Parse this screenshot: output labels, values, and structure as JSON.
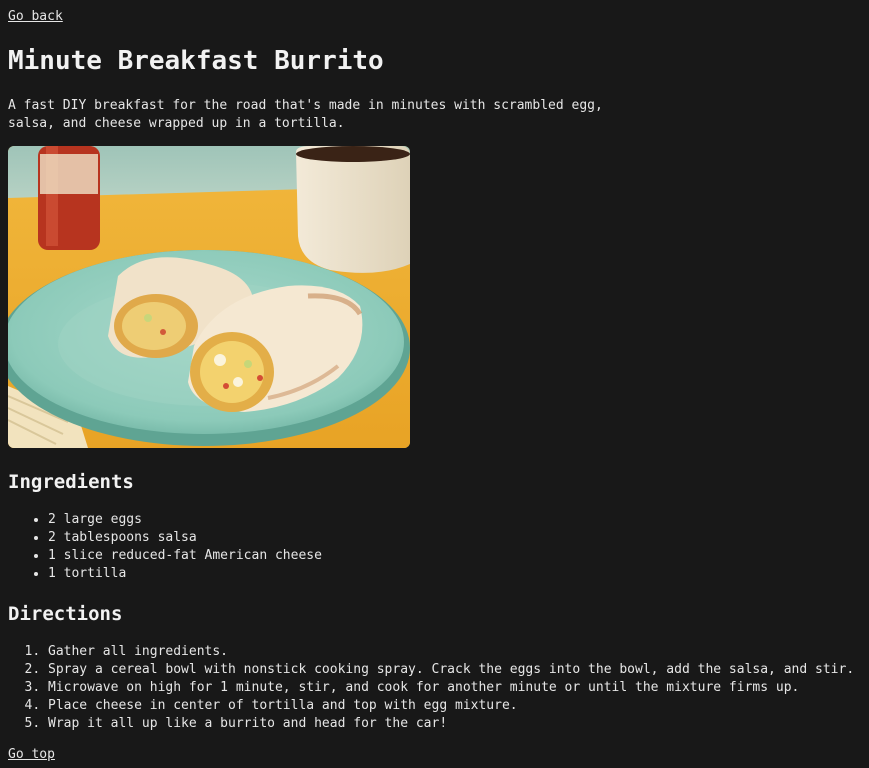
{
  "nav": {
    "back_label": "Go back",
    "top_label": "Go top"
  },
  "recipe": {
    "title": "Minute Breakfast Burrito",
    "description": "A fast DIY breakfast for the road that's made in minutes with scrambled egg, salsa, and cheese wrapped up in a tortilla.",
    "image_icon": "burrito-photo"
  },
  "ingredients": {
    "heading": "Ingredients",
    "items": [
      "2 large eggs",
      "2 tablespoons salsa",
      "1 slice reduced-fat American cheese",
      "1 tortilla"
    ]
  },
  "directions": {
    "heading": "Directions",
    "steps": [
      "Gather all ingredients.",
      "Spray a cereal bowl with nonstick cooking spray. Crack the eggs into the bowl, add the salsa, and stir.",
      "Microwave on high for 1 minute, stir, and cook for another minute or until the mixture firms up.",
      "Place cheese in center of tortilla and top with egg mixture.",
      "Wrap it all up like a burrito and head for the car!"
    ]
  }
}
